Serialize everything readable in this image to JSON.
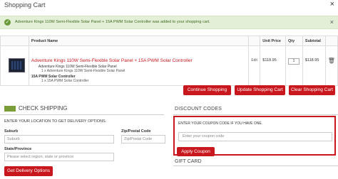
{
  "header": {
    "title": "Shopping Cart",
    "close": "×"
  },
  "alert": {
    "icon": "check-icon",
    "text": "Adventure Kings 110W Semi-Flexible Solar Panel + 15A PWM Solar Controller was added to your shopping cart.",
    "close": "×"
  },
  "table": {
    "headers": {
      "product": "Product Name",
      "price": "Unit Price",
      "qty": "Qty",
      "subtotal": "Subtotal"
    },
    "item": {
      "name": "Adventure Kings 110W Semi-Flexible Solar Panel + 15A PWM Solar Controller",
      "option1_title": "Adventure Kings 110W Semi-Flexible Solar Panel",
      "option1_line": "1 x Adventure Kings 110W Semi-Flexible Solar Panel",
      "option2_title": "15A PWM Solar Controller",
      "option2_line": "1 x 15A PWM Solar Controller",
      "edit": "Edit",
      "price": "$118.95",
      "qty": "1",
      "subtotal": "$118.95"
    }
  },
  "actions": {
    "continue": "Continue Shopping",
    "update": "Update Shopping Cart",
    "clear": "Clear Shopping Cart"
  },
  "shipping": {
    "heading": "CHECK SHIPPING",
    "instructions": "ENTER YOUR LOCATION TO GET DELIVERY OPTIONS.",
    "suburb_label": "Suburb",
    "suburb_placeholder": "Suburb",
    "postcode_label": "Zip/Postal Code",
    "postcode_placeholder": "Zip/Postal Code",
    "state_label": "State/Province",
    "state_placeholder": "Please select region, state or province",
    "button": "Get Delivery Options"
  },
  "discount": {
    "heading": "DISCOUNT CODES",
    "instructions": "ENTER YOUR COUPON CODE IF YOU HAVE ONE.",
    "placeholder": "Enter your coupon code",
    "button": "Apply Coupon"
  },
  "gift": {
    "heading": "GIFT CARD"
  },
  "colors": {
    "accent": "#c8181e",
    "alert_bg": "#e4efd8",
    "alert_text": "#3f6a1e"
  }
}
